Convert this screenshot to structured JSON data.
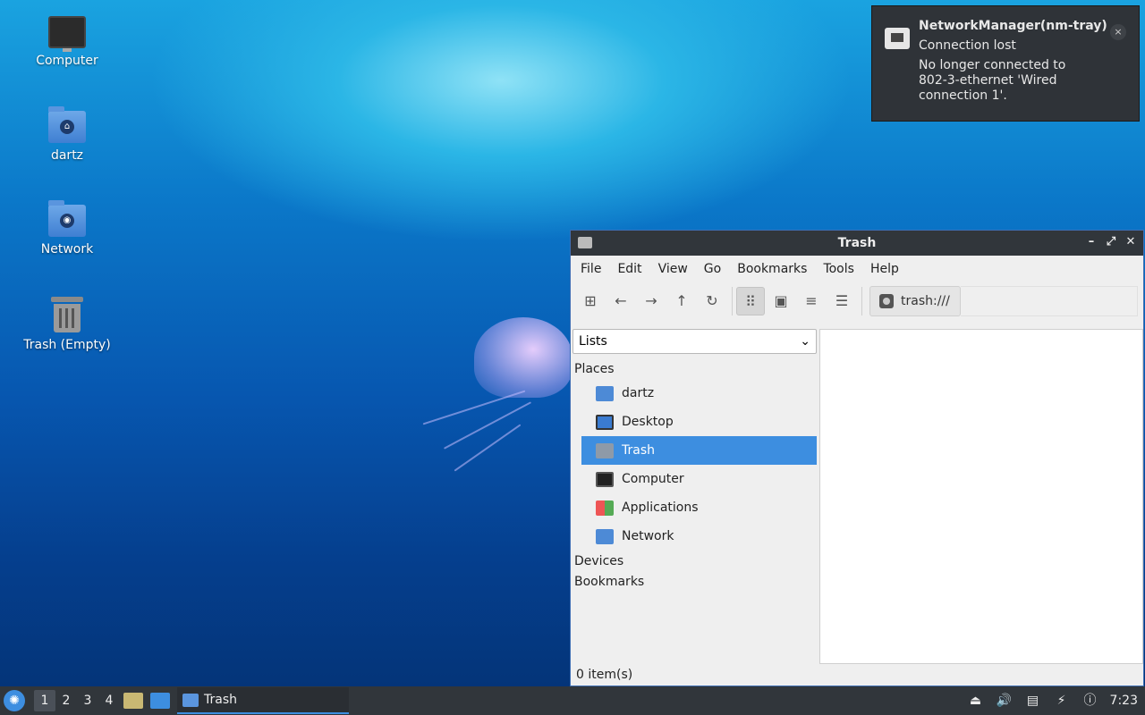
{
  "desktop": {
    "icons": [
      {
        "label": "Computer"
      },
      {
        "label": "dartz"
      },
      {
        "label": "Network"
      },
      {
        "label": "Trash (Empty)"
      }
    ]
  },
  "notification": {
    "app": "NetworkManager(nm-tray)",
    "summary": "Connection lost",
    "body": "No longer connected to 802-3-ethernet 'Wired connection 1'.",
    "close": "×"
  },
  "window": {
    "title": "Trash",
    "menu": [
      "File",
      "Edit",
      "View",
      "Go",
      "Bookmarks",
      "Tools",
      "Help"
    ],
    "location": "trash:///",
    "side_select": "Lists",
    "sections": {
      "places": "Places",
      "devices": "Devices",
      "bookmarks": "Bookmarks"
    },
    "places": [
      {
        "label": "dartz",
        "icon": "home-folder-icon"
      },
      {
        "label": "Desktop",
        "icon": "desktop-icon"
      },
      {
        "label": "Trash",
        "icon": "trash-icon"
      },
      {
        "label": "Computer",
        "icon": "computer-icon"
      },
      {
        "label": "Applications",
        "icon": "applications-icon"
      },
      {
        "label": "Network",
        "icon": "network-folder-icon"
      }
    ],
    "status": "0 item(s)"
  },
  "taskbar": {
    "workspaces": [
      "1",
      "2",
      "3",
      "4"
    ],
    "task_label": "Trash",
    "clock": "7:23"
  },
  "colors": {
    "accent": "#3d8ee0",
    "panel": "#31363b"
  }
}
